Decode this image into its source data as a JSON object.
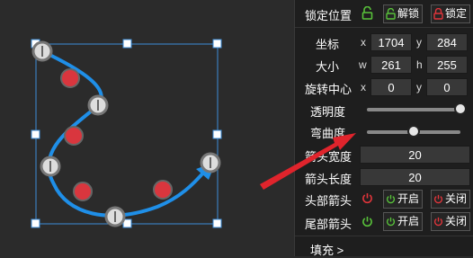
{
  "panel": {
    "lock_position": {
      "label": "锁定位置",
      "unlock_label": "解锁",
      "lock_label": "锁定"
    },
    "coords": {
      "label": "坐标",
      "x_axis": "x",
      "y_axis": "y",
      "x": "1704",
      "y": "284"
    },
    "size": {
      "label": "大小",
      "w_axis": "w",
      "h_axis": "h",
      "w": "261",
      "h": "255"
    },
    "rotation_center": {
      "label": "旋转中心",
      "x_axis": "x",
      "y_axis": "y",
      "x": "0",
      "y": "0"
    },
    "opacity": {
      "label": "透明度",
      "value": 1.0
    },
    "curvature": {
      "label": "弯曲度",
      "value": 0.5
    },
    "arrow_width": {
      "label": "箭头宽度",
      "value": "20"
    },
    "arrow_length": {
      "label": "箭头长度",
      "value": "20"
    },
    "head_arrow": {
      "label": "头部箭头",
      "on_label": "开启",
      "off_label": "关闭",
      "state": "off"
    },
    "tail_arrow": {
      "label": "尾部箭头",
      "on_label": "开启",
      "off_label": "关闭",
      "state": "on"
    },
    "fill": {
      "label": "填充 >"
    }
  },
  "colors": {
    "curve": "#1f8fe8",
    "selection": "#3c8ed8",
    "red_dot": "#d9363e",
    "lock_green": "#58c23a",
    "lock_red": "#e0353b",
    "pointer_arrow": "#e0242c"
  }
}
